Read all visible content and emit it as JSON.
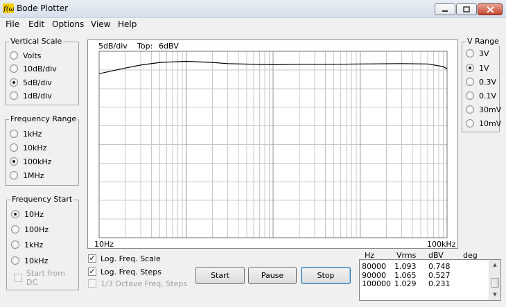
{
  "window": {
    "title": "Bode Plotter",
    "icon": "function-f-of-omega-icon",
    "controls": [
      "minimize",
      "maximize",
      "close"
    ]
  },
  "menu": [
    "File",
    "Edit",
    "Options",
    "View",
    "Help"
  ],
  "vertical_scale": {
    "title": "Vertical Scale",
    "options": [
      "Volts",
      "10dB/div",
      "5dB/div",
      "1dB/div"
    ],
    "selected": "5dB/div"
  },
  "frequency_range": {
    "title": "Frequency Range",
    "options": [
      "1kHz",
      "10kHz",
      "100kHz",
      "1MHz"
    ],
    "selected": "100kHz"
  },
  "frequency_start": {
    "title": "Frequency Start",
    "options": [
      "10Hz",
      "100Hz",
      "1kHz",
      "10kHz"
    ],
    "selected": "10Hz",
    "start_from_dc": "Start from DC"
  },
  "v_range": {
    "title": "V Range",
    "options": [
      "3V",
      "1V",
      "0.3V",
      "0.1V",
      "30mV",
      "10mV"
    ],
    "selected": "1V"
  },
  "plot": {
    "scale_label": "5dB/div",
    "top_label": "Top:",
    "top_value": "6dBV",
    "x_min_label": "10Hz",
    "x_max_label": "100kHz"
  },
  "chart_data": {
    "type": "line",
    "x_scale": "log",
    "xlim": [
      10,
      100000
    ],
    "ylim": [
      -44,
      6
    ],
    "y_unit": "dBV",
    "grid": true,
    "series": [
      {
        "x": [
          10,
          20,
          30,
          50,
          100,
          200,
          300,
          1000,
          2000,
          5000,
          10000,
          30000,
          60000,
          90000,
          100000
        ],
        "values": [
          0.0,
          1.5,
          2.3,
          3.0,
          3.3,
          3.0,
          2.7,
          2.4,
          2.5,
          2.5,
          2.6,
          2.7,
          2.6,
          1.9,
          1.3
        ]
      }
    ]
  },
  "options": {
    "log_freq_scale": {
      "label": "Log. Freq. Scale",
      "checked": true
    },
    "log_freq_steps": {
      "label": "Log. Freq. Steps",
      "checked": true
    },
    "third_octave": {
      "label": "1/3 Octave Freq. Steps",
      "checked": false,
      "enabled": false
    }
  },
  "buttons": {
    "start": "Start",
    "pause": "Pause",
    "stop": "Stop"
  },
  "results": {
    "headers": [
      "Hz",
      "Vrms",
      "dBV",
      "deg"
    ],
    "rows": [
      [
        "80000",
        "1.093",
        "0.748",
        ""
      ],
      [
        "90000",
        "1.065",
        "0.527",
        ""
      ],
      [
        "100000",
        "1.029",
        "0.231",
        ""
      ]
    ]
  }
}
